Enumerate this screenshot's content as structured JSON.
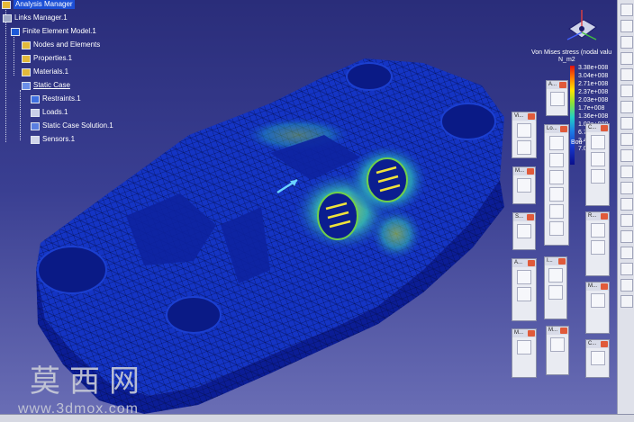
{
  "tree": {
    "items": [
      {
        "label": "Analysis Manager",
        "selected": true
      },
      {
        "label": "Links Manager.1"
      },
      {
        "label": "Finite Element Model.1"
      },
      {
        "label": "Nodes and Elements"
      },
      {
        "label": "Properties.1"
      },
      {
        "label": "Materials.1"
      },
      {
        "label": "Static Case",
        "underline": true
      },
      {
        "label": "Restraints.1"
      },
      {
        "label": "Loads.1"
      },
      {
        "label": "Static Case Solution.1"
      },
      {
        "label": "Sensors.1"
      }
    ]
  },
  "legend": {
    "title": "Von Mises stress (nodal valu",
    "unit": "N_m2",
    "values": [
      "3.38e+008",
      "3.04e+008",
      "2.71e+008",
      "2.37e+008",
      "2.03e+008",
      "1.7e+008",
      "1.36e+008",
      "1.02e+008",
      "6.79e+007",
      "3.43e+007",
      "7.02e+005"
    ],
    "bottom_label": "Bou"
  },
  "toolbars": [
    {
      "id": "view",
      "label": "Vi..."
    },
    {
      "id": "analysis",
      "label": "A..."
    },
    {
      "id": "loads",
      "label": "Lo..."
    },
    {
      "id": "c1",
      "label": "C..."
    },
    {
      "id": "m1",
      "label": "M..."
    },
    {
      "id": "s1",
      "label": "S..."
    },
    {
      "id": "r1",
      "label": "R..."
    },
    {
      "id": "a2",
      "label": "A..."
    },
    {
      "id": "i1",
      "label": "I..."
    },
    {
      "id": "m2",
      "label": "M..."
    },
    {
      "id": "m3",
      "label": "M..."
    },
    {
      "id": "m4",
      "label": "M..."
    },
    {
      "id": "c2",
      "label": "C..."
    }
  ],
  "watermark": {
    "text": "莫西网",
    "url": "www.3dmox.com"
  },
  "colors": {
    "background_top": "#2a2d7a",
    "background_bottom": "#6b6fb6",
    "mesh_low": "#0a1fb0",
    "mesh_high": "#ffe600"
  }
}
